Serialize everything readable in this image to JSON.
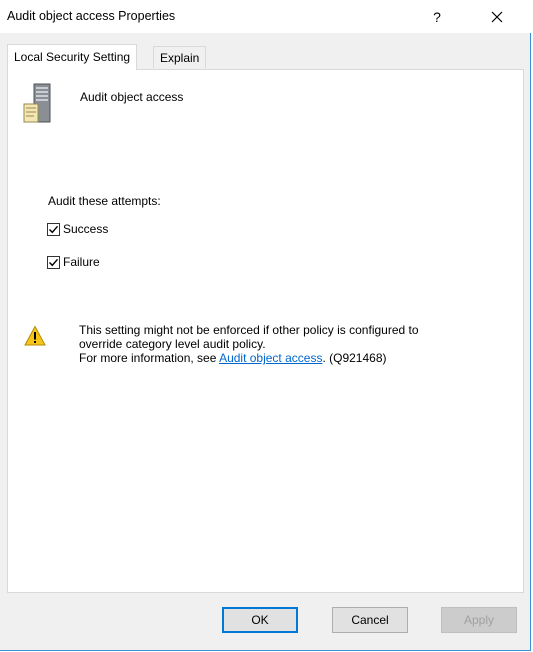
{
  "window": {
    "title": "Audit object access Properties",
    "help_label": "?",
    "close_label": "✕"
  },
  "tabs": [
    {
      "label": "Local Security Setting",
      "active": true
    },
    {
      "label": "Explain",
      "active": false
    }
  ],
  "policy": {
    "name": "Audit object access",
    "icon": "server-policy-icon"
  },
  "audit": {
    "group_label": "Audit these attempts:",
    "options": [
      {
        "label": "Success",
        "checked": true
      },
      {
        "label": "Failure",
        "checked": true
      }
    ]
  },
  "warning": {
    "icon": "warning-icon",
    "line1": "This setting might not be enforced if other policy is configured to",
    "line2": "override category level audit policy.",
    "line3_prefix": "For more information, see",
    "link_text": "Audit object access",
    "line3_suffix": ". (Q921468)"
  },
  "buttons": {
    "ok": "OK",
    "cancel": "Cancel",
    "apply": "Apply"
  },
  "colors": {
    "accent": "#0078d7",
    "link": "#0066cc",
    "window_border": "#3c8fd6"
  }
}
